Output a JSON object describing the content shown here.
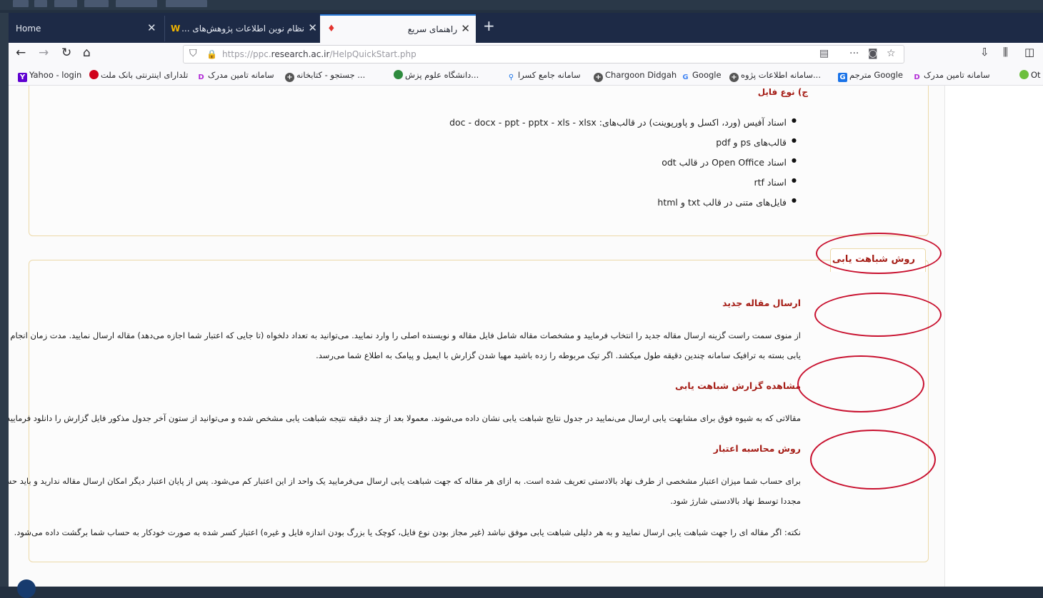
{
  "browser": {
    "tabs": [
      {
        "label": "Home"
      },
      {
        "label": "نظام نوین اطلاعات پژوهش‌های ..."
      },
      {
        "label": "راهنمای سریع",
        "active": true
      }
    ],
    "url": {
      "prefix": "https://ppc.",
      "domain": "research.ac.ir",
      "path": "/HelpQuickStart.php"
    },
    "bookmarks": [
      {
        "label": "Yahoo - login",
        "icon": "yahoo-icon",
        "color": "#5f01d1"
      },
      {
        "label": "تلدارای اینترنتی بانک ملت",
        "icon": "mellat-icon",
        "color": "#d0021b"
      },
      {
        "label": "سامانه تامین مدرک",
        "icon": "d-icon",
        "color": "#b12ad6"
      },
      {
        "label": "جستجو - کتابخانه ...",
        "icon": "globe-icon",
        "color": "#444"
      },
      {
        "label": "دانشگاه علوم پزش...",
        "icon": "leaf-icon",
        "color": "#2e8b3e"
      },
      {
        "label": "سامانه جامع کسرا",
        "icon": "pin-icon",
        "color": "#1a73e8"
      },
      {
        "label": "Chargoon Didgah",
        "icon": "globe-icon",
        "color": "#444"
      },
      {
        "label": "Google",
        "icon": "google-icon",
        "color": "#4285f4"
      },
      {
        "label": "سامانه اطلاعات پژوه...",
        "icon": "globe-icon",
        "color": "#444"
      },
      {
        "label": "مترجم Google",
        "icon": "translate-icon",
        "color": "#1a73e8"
      },
      {
        "label": "سامانه تامین مدرک",
        "icon": "d-icon",
        "color": "#b12ad6"
      },
      {
        "label": "Ot",
        "icon": "green-icon",
        "color": "#6cbf3c"
      }
    ]
  },
  "page": {
    "file_types_title": "ج) نوع فایل",
    "file_types": [
      "اسناد آفیس (ورد، اکسل و پاورپوینت) در قالب‌های: doc - docx - ppt - pptx - xls - xlsx",
      "قالب‌های ps و pdf",
      "اسناد Open Office در قالب odt",
      "اسناد rtf",
      "فایل‌های متنی در قالب txt و html"
    ],
    "method_tab": "روش شباهت یابی",
    "sections": {
      "new_article_title": "ارسال مقاله جدید",
      "new_article_line1": "از منوی سمت راست گزینه ارسال مقاله جدید را انتخاب فرمایید و مشخصات مقاله شامل فایل مقاله و نویسنده اصلی را وارد نمایید. می‌توانید به تعداد دلخواه (تا جایی که اعتبار شما اجازه می‌دهد) مقاله ارسال نمایید. مدت زمان انجام شباهت",
      "new_article_line2": "یابی بسته به ترافیک سامانه چندین دقیقه طول میکشد. اگر تیک مربوطه را زده باشید مهیا شدن گزارش با ایمیل و پیامک به اطلاع شما می‌رسد.",
      "report_title": "مشاهده گزارش شباهت یابی",
      "report_line": "مقالاتی که به شیوه فوق برای مشابهت یابی ارسال می‌نمایید در جدول نتایج شباهت یابی نشان داده می‌شوند. معمولا بعد از چند دقیقه نتیجه شباهت یابی مشخص شده و می‌توانید از ستون آخر جدول مذکور فایل گزارش را دانلود فرمایید.",
      "credit_title": "روش محاسبه اعتبار",
      "credit_line1": "برای حساب شما میزان اعتبار مشخصی از طرف نهاد بالادستی تعریف شده است. به ازای هر مقاله که جهت شباهت یابی ارسال می‌فرمایید یک واحد از این اعتبار کم می‌شود. پس از پایان اعتبار دیگر امکان ارسال مقاله ندارید و باید حساب شما باید",
      "credit_line2": "مجددا توسط نهاد بالادستی شارژ شود.",
      "note_line": "نکته: اگر مقاله ای را جهت شباهت یابی ارسال نمایید و به هر دلیلی شباهت یابی موفق نباشد (غیر مجاز بودن نوع فایل، کوچک یا بزرگ بودن اندازه فایل و غیره) اعتبار کسر شده به صورت خودکار به حساب شما برگشت داده می‌شود."
    }
  },
  "colors": {
    "accent_red": "#a51d16",
    "annotation_red": "#c8102e",
    "panel_border": "#ecd9a8"
  }
}
